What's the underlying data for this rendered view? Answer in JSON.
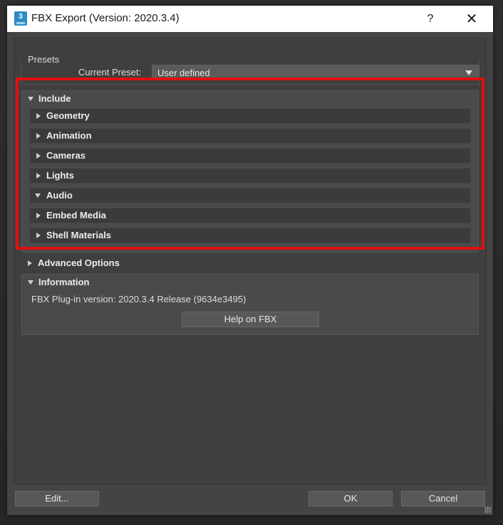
{
  "window": {
    "title": "FBX Export (Version: 2020.3.4)",
    "icon_label": "3",
    "help_glyph": "?",
    "close_glyph": "✕"
  },
  "presets": {
    "group_label": "Presets",
    "current_label": "Current Preset:",
    "current_value": "User defined"
  },
  "include": {
    "title": "Include",
    "expanded": true,
    "items": [
      {
        "label": "Geometry",
        "expanded": false
      },
      {
        "label": "Animation",
        "expanded": false
      },
      {
        "label": "Cameras",
        "expanded": false
      },
      {
        "label": "Lights",
        "expanded": false
      },
      {
        "label": "Audio",
        "expanded": true
      },
      {
        "label": "Embed Media",
        "expanded": false
      },
      {
        "label": "Shell Materials",
        "expanded": false
      }
    ]
  },
  "advanced": {
    "title": "Advanced Options",
    "expanded": false
  },
  "information": {
    "title": "Information",
    "expanded": true,
    "version_text": "FBX Plug-in version: 2020.3.4 Release (9634e3495)",
    "help_button": "Help on FBX"
  },
  "footer": {
    "edit_label": "Edit...",
    "ok_label": "OK",
    "cancel_label": "Cancel"
  },
  "colors": {
    "highlight": "#e00f0f",
    "dialog_bg": "#444444",
    "titlebar_bg": "#ffffff"
  }
}
